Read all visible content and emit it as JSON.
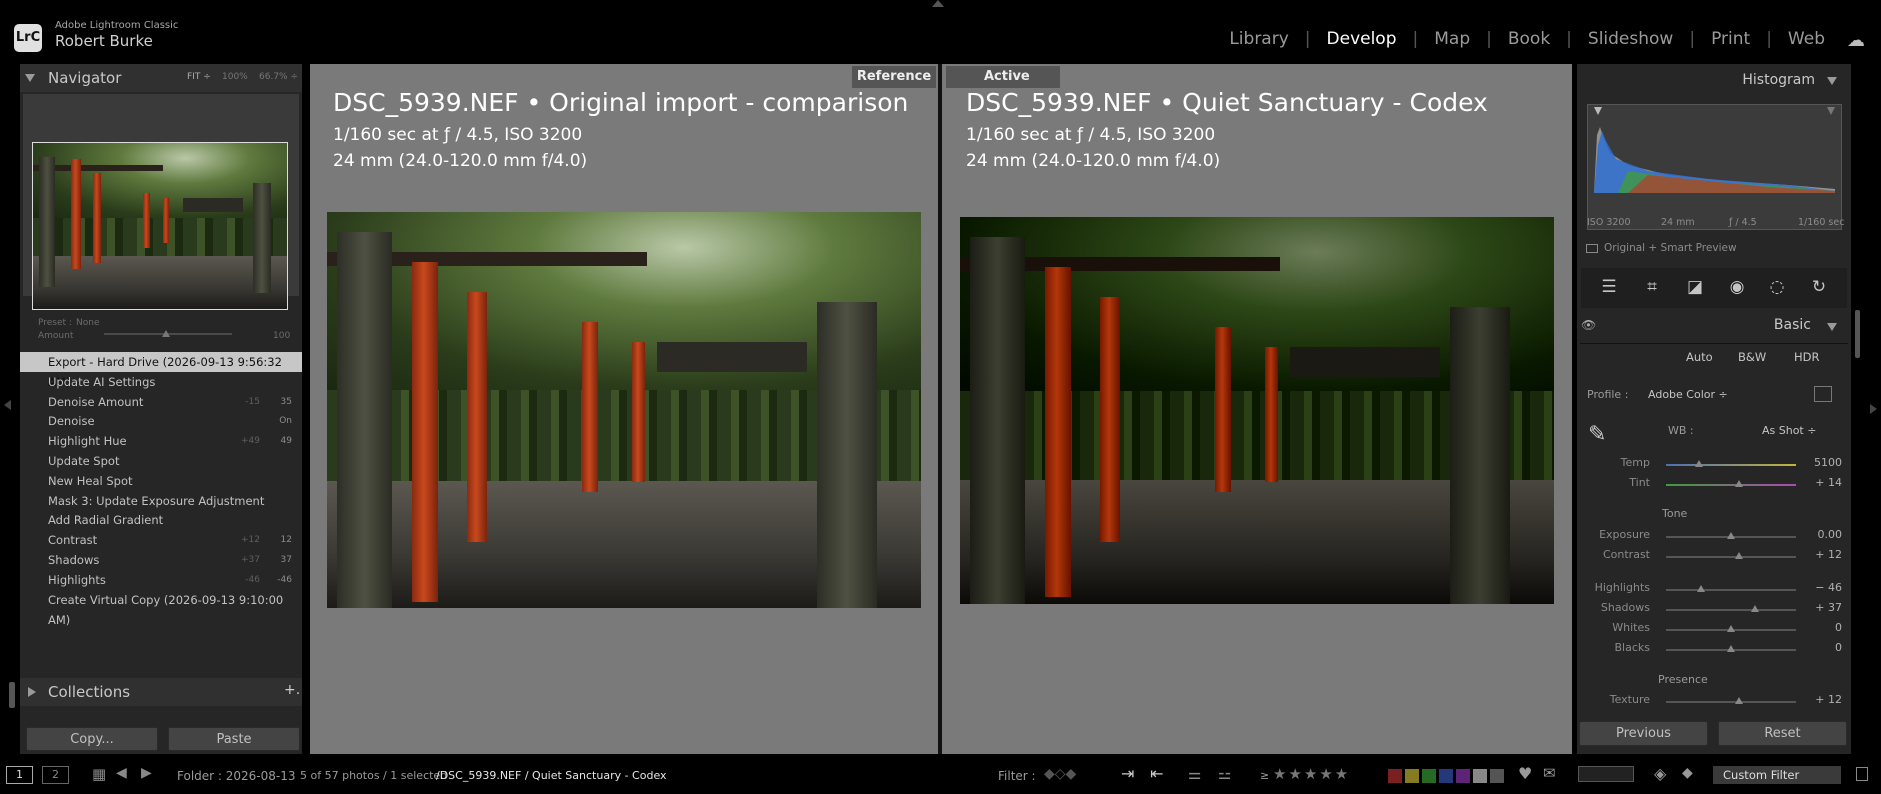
{
  "app": {
    "name": "Adobe Lightroom Classic",
    "user": "Robert Burke",
    "logo": "LrC"
  },
  "modules": [
    "Library",
    "Develop",
    "Map",
    "Book",
    "Slideshow",
    "Print",
    "Web"
  ],
  "active_module": "Develop",
  "navigator": {
    "title": "Navigator",
    "zoom_fit": "FIT ÷",
    "zoom_100": "100%",
    "zoom_667": "66.7% ÷"
  },
  "preset": {
    "label": "Preset :",
    "value": "None",
    "amount_label": "Amount",
    "amount_value": "100",
    "amount_fraction": 0.5
  },
  "history": [
    {
      "label": "Export - Hard Drive (2026-09-13 9:56:32 AM)",
      "v1": "",
      "v2": "",
      "selected": true
    },
    {
      "label": "Update AI Settings",
      "v1": "",
      "v2": ""
    },
    {
      "label": "Denoise Amount",
      "v1": "-15",
      "v2": "35"
    },
    {
      "label": "Denoise",
      "v1": "",
      "v2": "On"
    },
    {
      "label": "Highlight Hue",
      "v1": "+49",
      "v2": "49"
    },
    {
      "label": "Update Spot",
      "v1": "",
      "v2": ""
    },
    {
      "label": "New Heal Spot",
      "v1": "",
      "v2": ""
    },
    {
      "label": "Mask 3: Update Exposure Adjustment",
      "v1": "",
      "v2": ""
    },
    {
      "label": "Add Radial Gradient",
      "v1": "",
      "v2": ""
    },
    {
      "label": "Contrast",
      "v1": "+12",
      "v2": "12"
    },
    {
      "label": "Shadows",
      "v1": "+37",
      "v2": "37"
    },
    {
      "label": "Highlights",
      "v1": "-46",
      "v2": "-46"
    },
    {
      "label": "Create Virtual Copy (2026-09-13 9:10:00 AM)",
      "v1": "",
      "v2": ""
    }
  ],
  "collections": {
    "title": "Collections",
    "add": "+."
  },
  "left_buttons": {
    "copy": "Copy...",
    "paste": "Paste"
  },
  "reference": {
    "tag": "Reference",
    "title": "DSC_5939.NEF  •  Original import - comparison",
    "line1": "1/160 sec at ƒ / 4.5, ISO 3200",
    "line2": "24 mm (24.0-120.0 mm f/4.0)"
  },
  "active": {
    "tag": "Active",
    "title": "DSC_5939.NEF  •  Quiet Sanctuary - Codex",
    "line1": "1/160 sec at ƒ / 4.5, ISO 3200",
    "line2": "24 mm (24.0-120.0 mm f/4.0)"
  },
  "histogram": {
    "title": "Histogram",
    "iso": "ISO 3200",
    "focal": "24 mm",
    "aperture": "ƒ / 4.5",
    "shutter": "1/160 sec",
    "preview_label": "Original + Smart Preview"
  },
  "tools": [
    "sliders-icon",
    "crop-icon",
    "eraser-icon",
    "redeye-icon",
    "masking-icon",
    "reset-icon"
  ],
  "basic": {
    "title": "Basic",
    "auto": "Auto",
    "bw": "B&W",
    "hdr": "HDR",
    "profile_label": "Profile :",
    "profile_value": "Adobe Color ÷",
    "wb_label": "WB :",
    "wb_value": "As Shot ÷",
    "tone_label": "Tone",
    "presence_label": "Presence",
    "sliders": [
      {
        "label": "Temp",
        "value": "5100",
        "pos": 0.25
      },
      {
        "label": "Tint",
        "value": "+ 14",
        "pos": 0.56
      },
      {
        "label": "Exposure",
        "value": "0.00",
        "pos": 0.5
      },
      {
        "label": "Contrast",
        "value": "+ 12",
        "pos": 0.56
      },
      {
        "label": "Highlights",
        "value": "− 46",
        "pos": 0.27
      },
      {
        "label": "Shadows",
        "value": "+ 37",
        "pos": 0.685
      },
      {
        "label": "Whites",
        "value": "0",
        "pos": 0.5
      },
      {
        "label": "Blacks",
        "value": "0",
        "pos": 0.5
      },
      {
        "label": "Texture",
        "value": "+ 12",
        "pos": 0.56
      }
    ]
  },
  "right_buttons": {
    "previous": "Previous",
    "reset": "Reset"
  },
  "filmstrip": {
    "view1": "1",
    "view2": "2",
    "folder": "Folder : 2026-08-13",
    "count": "5 of 57 photos / 1 selected",
    "path": "/DSC_5939.NEF / Quiet Sanctuary - Codex",
    "filter_label": "Filter :",
    "custom_filter": "Custom Filter",
    "stars_prefix": "≥"
  },
  "colors": {
    "accent_selected": "#c7c7c7",
    "panel": "#262626",
    "center": "#7a7a7a",
    "temp_blue": "#4a6fb5",
    "temp_yellow": "#c4b43a",
    "tint_green": "#3f9a3f",
    "tint_magenta": "#b04ab0"
  }
}
